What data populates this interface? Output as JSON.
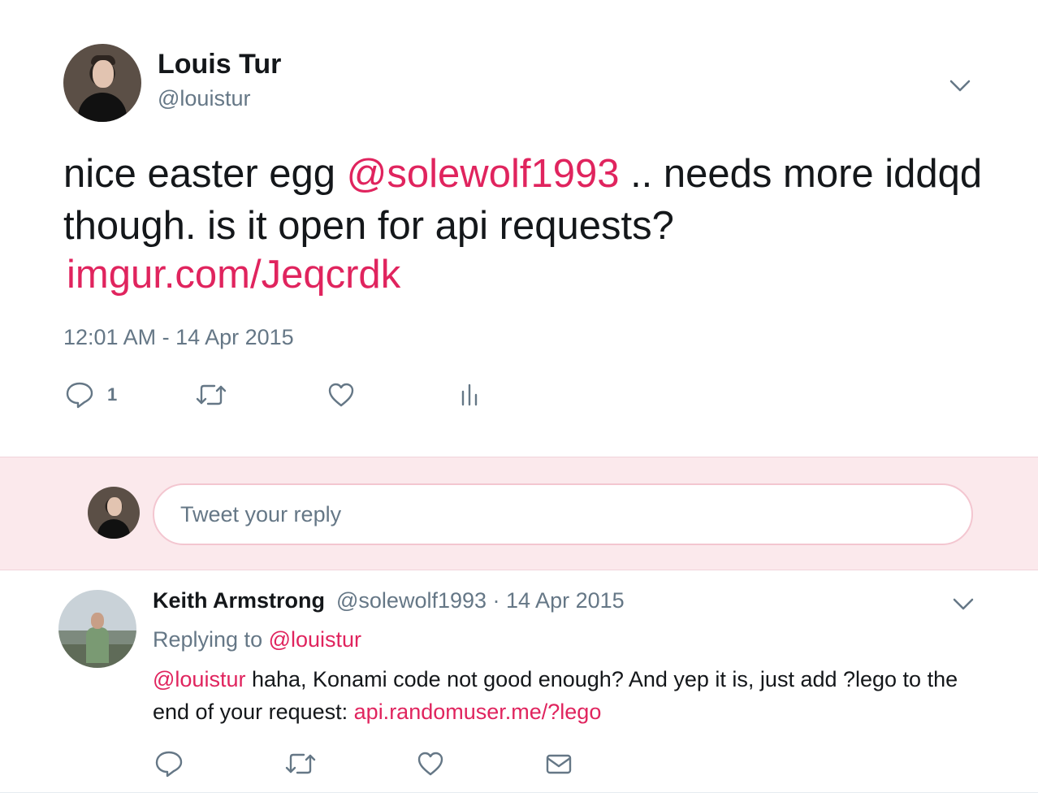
{
  "tweet": {
    "author_name": "Louis Tur",
    "author_handle": "@louistur",
    "text_part1": "nice easter egg ",
    "mention": "@solewolf1993",
    "text_part2": " .. needs more iddqd though. is it open for api requests?",
    "link": "imgur.com/Jeqcrdk",
    "timestamp": "12:01 AM - 14 Apr 2015",
    "reply_count": "1",
    "icons": [
      "chevron-down-icon",
      "reply-icon",
      "retweet-icon",
      "like-icon",
      "analytics-icon"
    ]
  },
  "reply_box": {
    "placeholder": "Tweet your reply"
  },
  "reply": {
    "author_name": "Keith Armstrong",
    "meta": "@solewolf1993 · 14 Apr 2015",
    "replying_label": "Replying to ",
    "replying_handle": "@louistur",
    "mention": "@louistur",
    "text": " haha, Konami code not good enough? And yep it is, just add ?lego to the end of your request: ",
    "link": "api.randomuser.me/?lego",
    "icons": [
      "chevron-down-icon",
      "reply-icon",
      "retweet-icon",
      "like-icon",
      "message-icon"
    ]
  },
  "colors": {
    "accent": "#e0245e",
    "secondary_text": "#657786",
    "reply_box_background": "#fbe9ec"
  }
}
